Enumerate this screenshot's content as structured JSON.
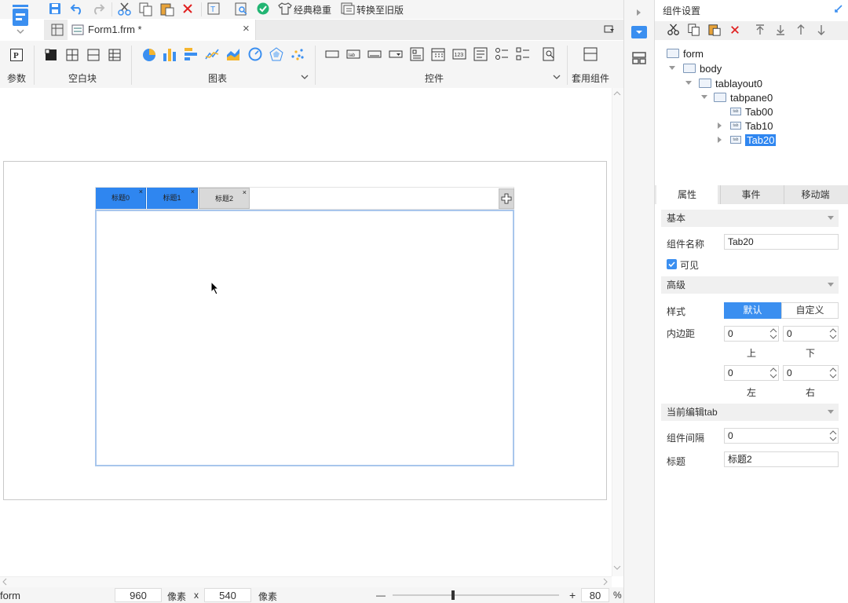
{
  "toolbar": {
    "classic_label": "经典稳重",
    "convert_label": "转换至旧版"
  },
  "doc_tab": {
    "title": "Form1.frm *",
    "close": "×"
  },
  "ribbon": {
    "param_label": "参数",
    "blank_label": "空白块",
    "chart_label": "图表",
    "control_label": "控件",
    "template_label": "套用组件"
  },
  "canvas": {
    "tabs": [
      {
        "label": "标题0",
        "active": true
      },
      {
        "label": "标题1",
        "active": true
      },
      {
        "label": "标题2",
        "active": false
      }
    ],
    "tab_close": "×"
  },
  "statusbar": {
    "name": "form",
    "width": "960",
    "unit1": "像素",
    "times": "x",
    "height": "540",
    "unit2": "像素",
    "minus": "—",
    "plus": "+",
    "zoom": "80",
    "percent": "%"
  },
  "right_panel": {
    "title": "组件设置",
    "tree": [
      {
        "label": "form",
        "depth": 0
      },
      {
        "label": "body",
        "depth": 1
      },
      {
        "label": "tablayout0",
        "depth": 2
      },
      {
        "label": "tabpane0",
        "depth": 3
      },
      {
        "label": "Tab00",
        "depth": 4
      },
      {
        "label": "Tab10",
        "depth": 4
      },
      {
        "label": "Tab20",
        "depth": 4,
        "selected": true
      }
    ],
    "prop_tabs": [
      "属性",
      "事件",
      "移动端"
    ],
    "sections": {
      "basic": "基本",
      "advanced": "高级",
      "current_tab": "当前编辑tab"
    },
    "props": {
      "name_label": "组件名称",
      "name_value": "Tab20",
      "visible_label": "可见",
      "style_label": "样式",
      "style_default": "默认",
      "style_custom": "自定义",
      "padding_label": "内边距",
      "pad_top": "0",
      "pad_bottom": "0",
      "pad_left": "0",
      "pad_right": "0",
      "top_label": "上",
      "bottom_label": "下",
      "left_label": "左",
      "right_label": "右",
      "gap_label": "组件间隔",
      "gap_value": "0",
      "title_label": "标题",
      "title_value": "标题2"
    }
  },
  "colors": {
    "accent": "#3b8ff0",
    "active_tab": "#2f86f0",
    "selected_tree": "#2f86f0",
    "panel_bg": "#f5f5f5"
  }
}
